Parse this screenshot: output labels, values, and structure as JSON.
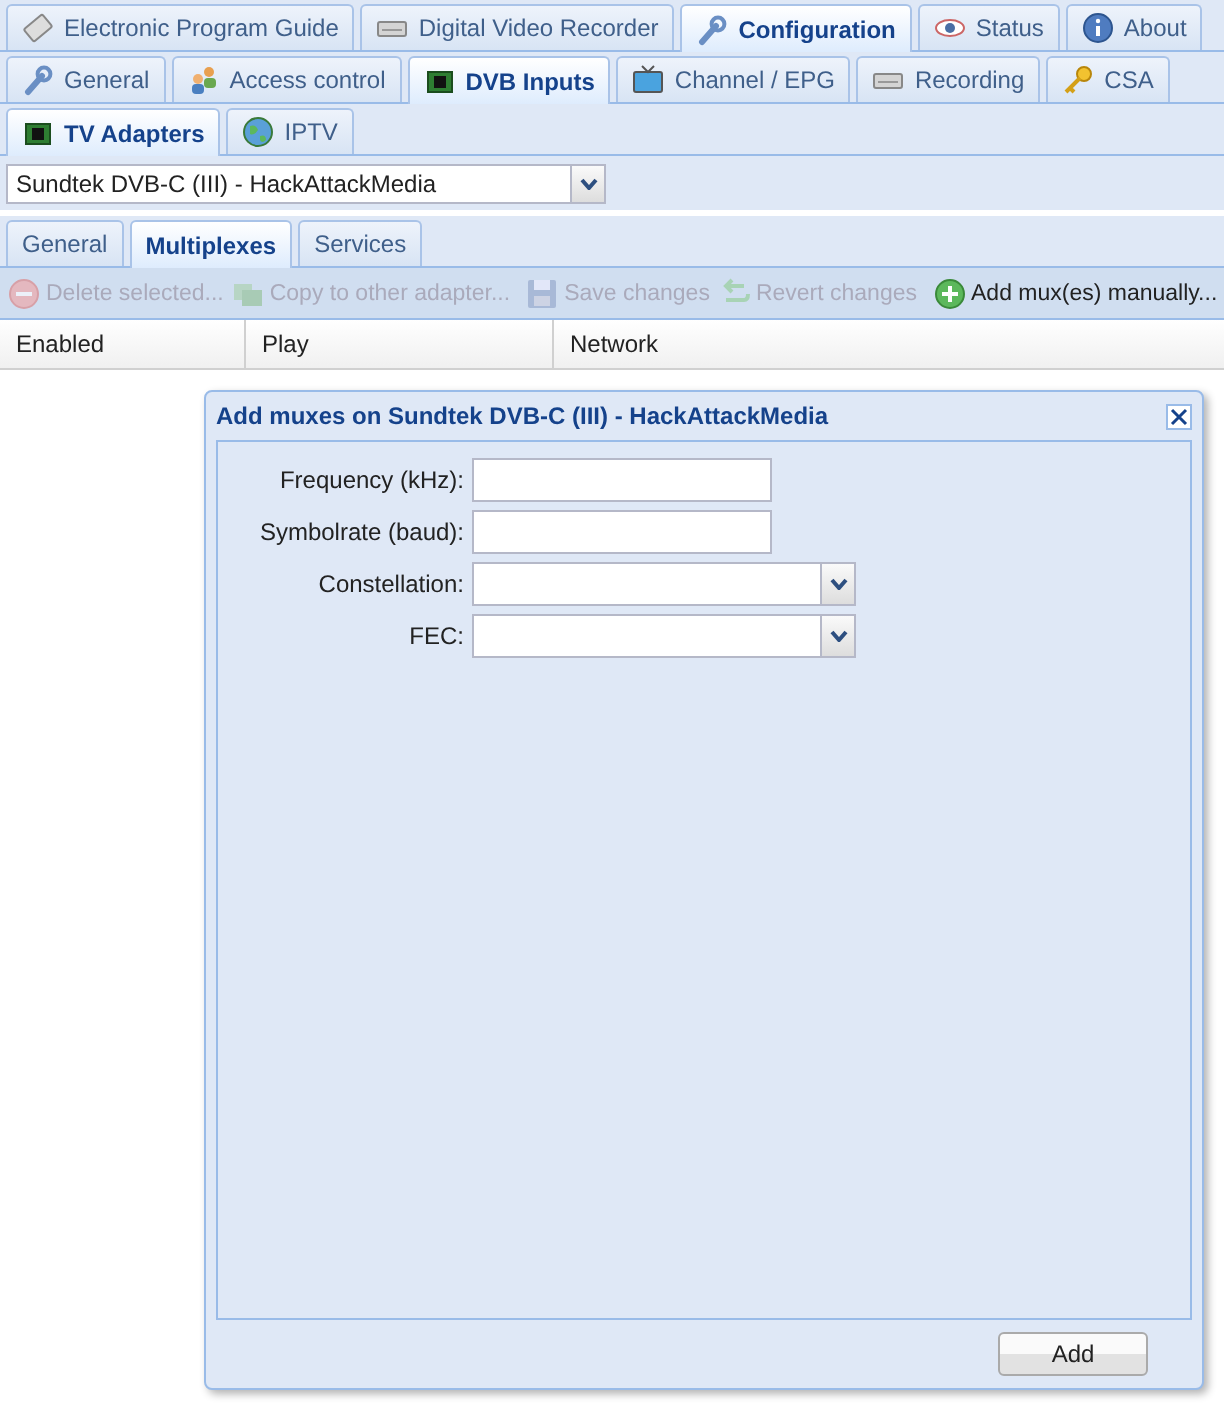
{
  "main_tabs": [
    {
      "label": "Electronic Program Guide",
      "selected": false
    },
    {
      "label": "Digital Video Recorder",
      "selected": false
    },
    {
      "label": "Configuration",
      "selected": true
    },
    {
      "label": "Status",
      "selected": false
    },
    {
      "label": "About",
      "selected": false
    }
  ],
  "config_tabs": [
    {
      "label": "General",
      "selected": false
    },
    {
      "label": "Access control",
      "selected": false
    },
    {
      "label": "DVB Inputs",
      "selected": true
    },
    {
      "label": "Channel / EPG",
      "selected": false
    },
    {
      "label": "Recording",
      "selected": false
    },
    {
      "label": "CSA",
      "selected": false
    }
  ],
  "input_tabs": [
    {
      "label": "TV Adapters",
      "selected": true
    },
    {
      "label": "IPTV",
      "selected": false
    }
  ],
  "adapter_select": {
    "value": "Sundtek DVB-C (III) - HackAttackMedia"
  },
  "adapter_tabs": [
    {
      "label": "General",
      "selected": false
    },
    {
      "label": "Multiplexes",
      "selected": true
    },
    {
      "label": "Services",
      "selected": false
    }
  ],
  "toolbar": [
    {
      "label": "Delete selected...",
      "disabled": true
    },
    {
      "label": "Copy to other adapter...",
      "disabled": true
    },
    {
      "label": "Save changes",
      "disabled": true
    },
    {
      "label": "Revert changes",
      "disabled": true
    },
    {
      "label": "Add mux(es) manually...",
      "disabled": false
    }
  ],
  "table": {
    "columns": [
      "Enabled",
      "Play",
      "Network"
    ]
  },
  "dialog": {
    "title": "Add muxes on Sundtek DVB-C (III) - HackAttackMedia",
    "fields": [
      {
        "label": "Frequency (kHz):",
        "kind": "text"
      },
      {
        "label": "Symbolrate (baud):",
        "kind": "text"
      },
      {
        "label": "Constellation:",
        "kind": "combo"
      },
      {
        "label": "FEC:",
        "kind": "combo"
      }
    ],
    "button": "Add"
  }
}
